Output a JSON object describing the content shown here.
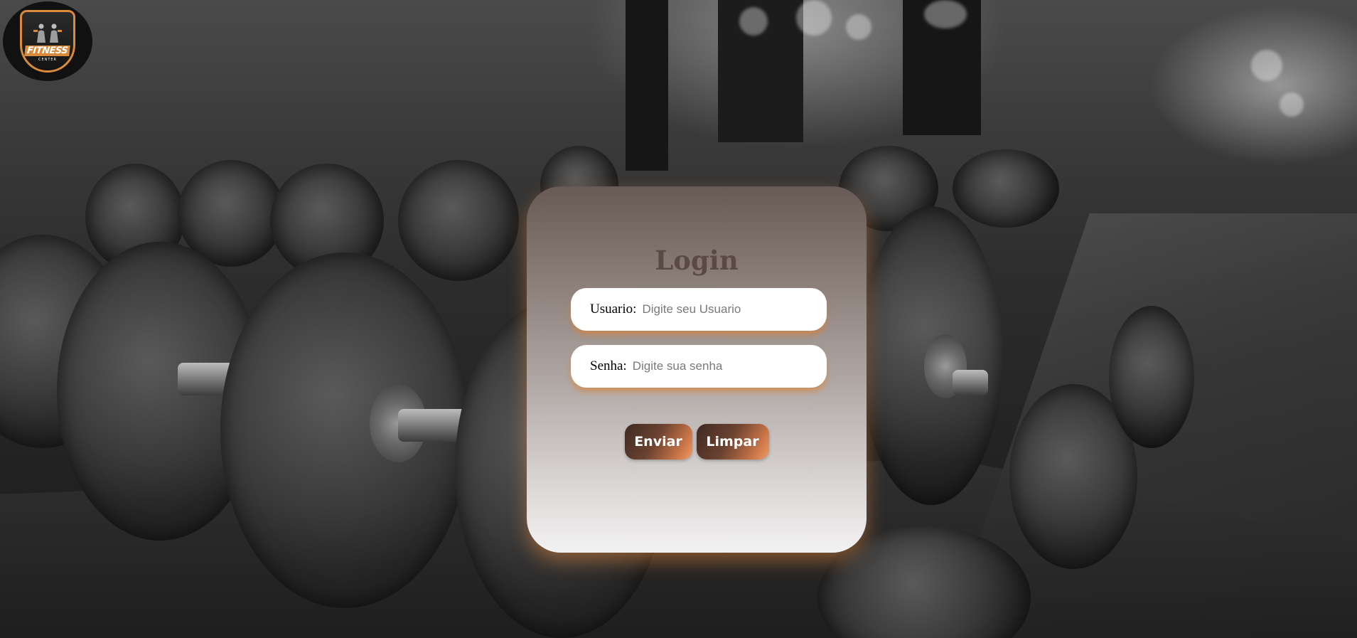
{
  "brand": {
    "logo_name": "FITNESS",
    "logo_sub": "CENTER",
    "accent_color": "#d98a3a"
  },
  "login": {
    "title": "Login",
    "username_label": "Usuario:",
    "username_placeholder": "Digite seu Usuario",
    "password_label": "Senha:",
    "password_placeholder": "Digite sua senha",
    "submit_label": "Enviar",
    "clear_label": "Limpar"
  },
  "colors": {
    "card_top": "#675a55",
    "card_bottom": "#f3f2f2",
    "title": "#5b4a43",
    "button_dark": "#3e2a22",
    "button_light": "#f09a63",
    "glow": "#e87d28"
  }
}
